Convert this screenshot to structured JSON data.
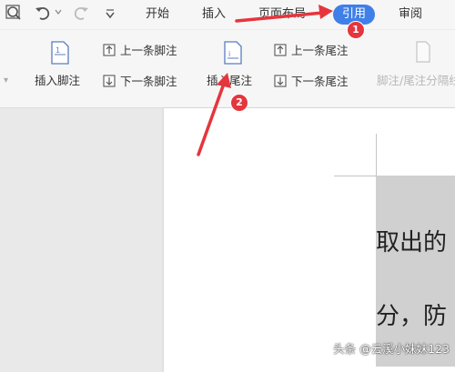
{
  "menu": {
    "tabs": [
      {
        "label": "开始"
      },
      {
        "label": "插入"
      },
      {
        "label": "页面布局"
      },
      {
        "label": "引用"
      },
      {
        "label": "审阅"
      }
    ],
    "active_tab": "引用"
  },
  "ribbon": {
    "insert_footnote": "插入脚注",
    "prev_footnote": "上一条脚注",
    "next_footnote": "下一条脚注",
    "insert_endnote": "插入尾注",
    "prev_endnote": "上一条尾注",
    "next_endnote": "下一条尾注",
    "footnote_endnote_separator": "脚注/尾注分隔线"
  },
  "document": {
    "line1": "取出的",
    "line2": "分，防"
  },
  "annotations": {
    "badge1": "1",
    "badge2": "2"
  },
  "watermark": "头条 @云溪小妹妹123",
  "colors": {
    "active_tab_bg": "#3f7fe8",
    "annotation_red": "#e5353d",
    "ribbon_bg": "#f6f6f6"
  },
  "icons": [
    "print-preview-icon",
    "undo-icon",
    "redo-icon",
    "customize-icon",
    "footnote-icon",
    "endnote-icon",
    "prev-icon",
    "next-icon"
  ]
}
